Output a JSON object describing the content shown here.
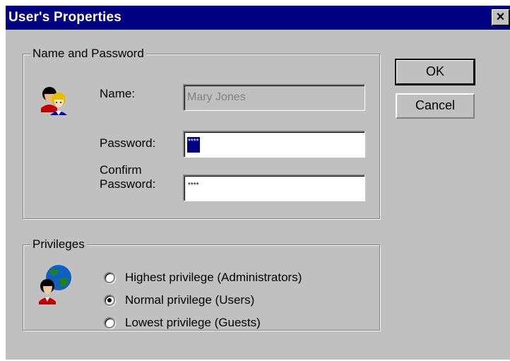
{
  "window": {
    "title": "User's Properties",
    "close_glyph": "×"
  },
  "name_password": {
    "group_label": "Name and Password",
    "name_label": "Name:",
    "name_value": "Mary Jones",
    "password_label": "Password:",
    "password_value": "****",
    "confirm_label_line1": "Confirm",
    "confirm_label_line2": "Password:",
    "confirm_value": "****"
  },
  "buttons": {
    "ok": "OK",
    "cancel": "Cancel"
  },
  "privileges": {
    "group_label": "Privileges",
    "options": [
      {
        "label": "Highest privilege (Administrators)",
        "selected": false
      },
      {
        "label": "Normal privilege (Users)",
        "selected": true
      },
      {
        "label": "Lowest privilege (Guests)",
        "selected": false
      }
    ]
  },
  "icons": {
    "users": "two-users-icon",
    "network": "globe-user-icon"
  },
  "colors": {
    "titlebar": "#000080",
    "face": "#c0c0c0",
    "selection": "#000080"
  }
}
